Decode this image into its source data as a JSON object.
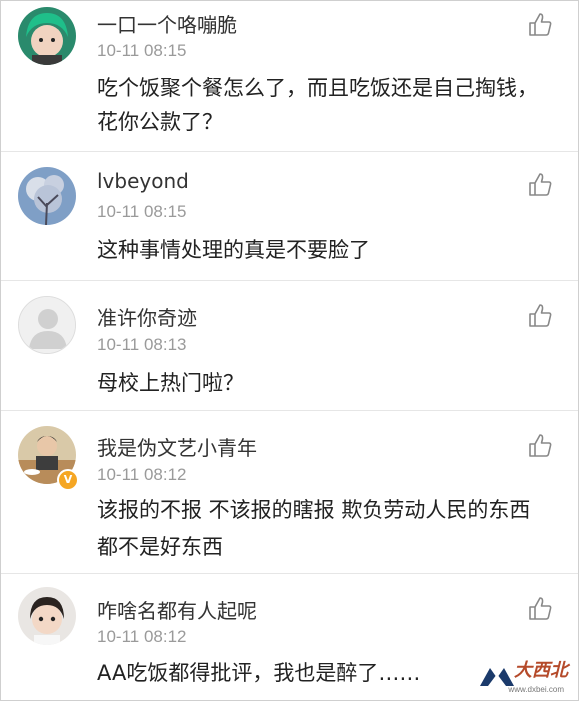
{
  "comments": [
    {
      "user": "一口一个咯嘣脆",
      "time": "10-11 08:15",
      "text": "吃个饭聚个餐怎么了，而且吃饭还是自己掏钱，花你公款了？",
      "avatar": "avatar-green-hair",
      "verified": false
    },
    {
      "user": "lvbeyond",
      "time": "10-11 08:15",
      "text": "这种事情处理的真是不要脸了",
      "avatar": "avatar-blossom-tree",
      "verified": false
    },
    {
      "user": "准许你奇迹",
      "time": "10-11 08:13",
      "text": "母校上热门啦？",
      "avatar": "avatar-default",
      "verified": false
    },
    {
      "user": "我是伪文艺小青年",
      "time": "10-11 08:12",
      "text": "该报的不报 不该报的瞎报 欺负劳动人民的东西都不是好东西",
      "avatar": "avatar-person-dining",
      "verified": true
    },
    {
      "user": "咋啥名都有人起呢",
      "time": "10-11 08:12",
      "text": "AA吃饭都得批评，我也是醉了……",
      "avatar": "avatar-child",
      "verified": false
    }
  ],
  "like_icon": "thumbs-up-icon",
  "verified_badge": "V",
  "watermark": {
    "text": "大西北",
    "url": "www.dxbei.com"
  },
  "colors": {
    "name": "#333333",
    "time": "#9a9a9a",
    "text": "#222222",
    "divider": "#e6e6e6",
    "badge": "#f5a623"
  }
}
